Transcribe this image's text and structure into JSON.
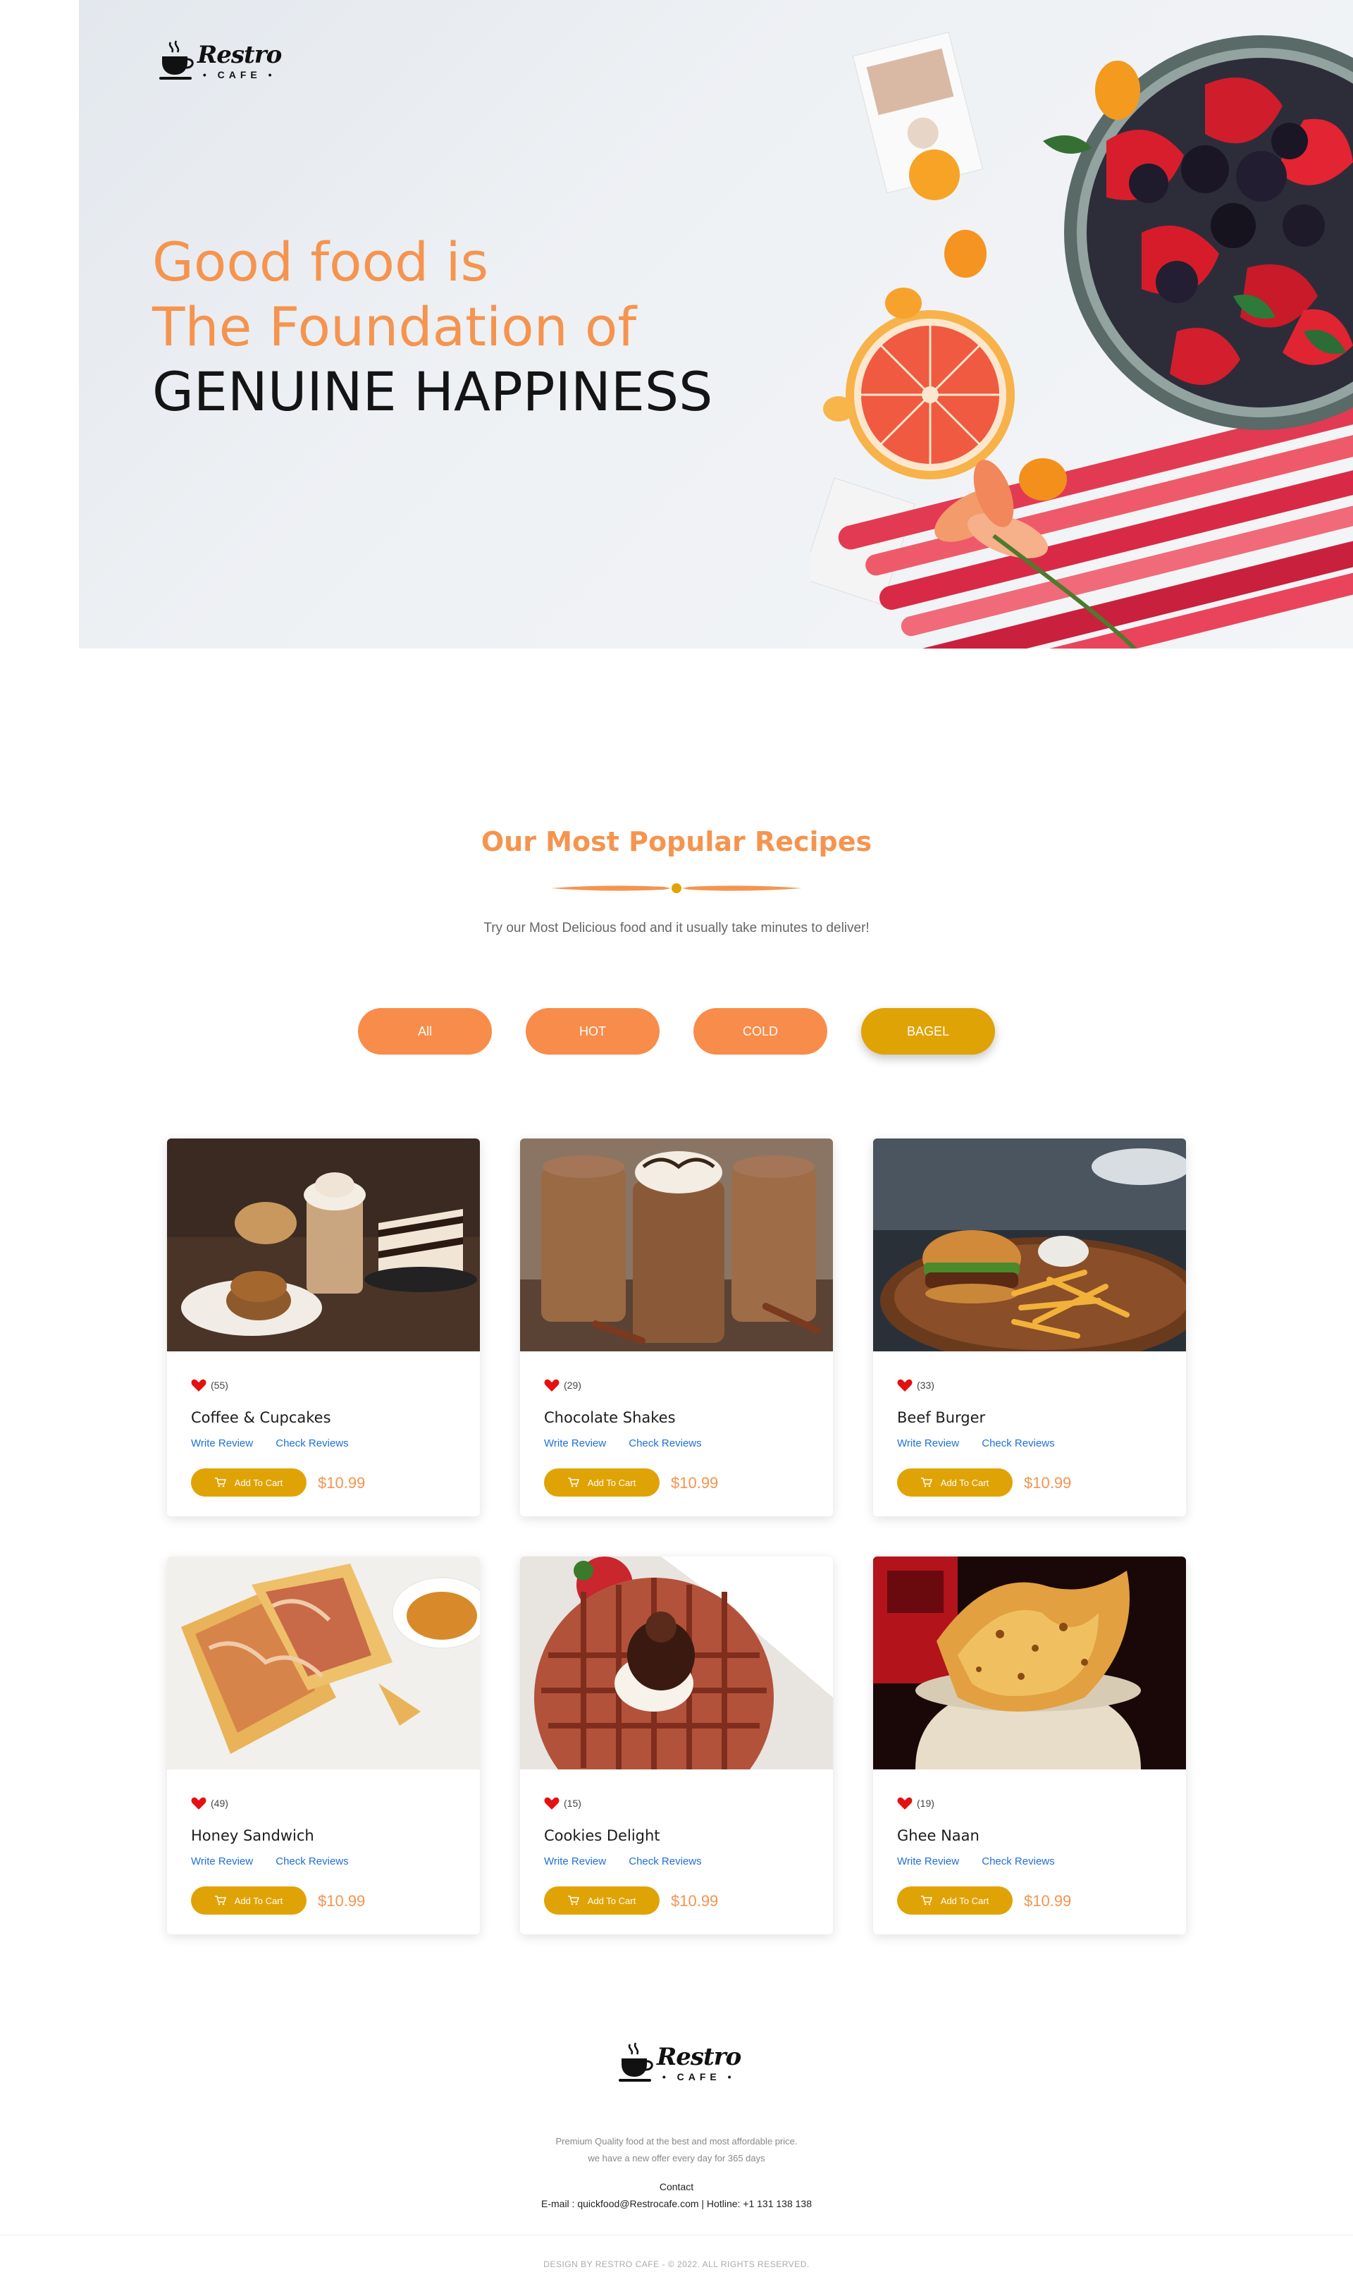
{
  "brand": {
    "name": "Restro",
    "sub": "• CAFE •"
  },
  "hero": {
    "line1": "Good food is",
    "line2": "The Foundation of",
    "line3": "GENUINE HAPPINESS"
  },
  "popular": {
    "title": "Our Most Popular Recipes",
    "subtitle": "Try our Most Delicious food and it usually take minutes to deliver!",
    "filters": [
      {
        "label": "All",
        "active": false
      },
      {
        "label": "HOT",
        "active": false
      },
      {
        "label": "COLD",
        "active": false
      },
      {
        "label": "BAGEL",
        "active": true
      }
    ],
    "items": [
      {
        "name": "Coffee & Cupcakes",
        "rating": "(55)",
        "write_review": "Write Review",
        "check_reviews": "Check Reviews",
        "cart_label": "Add To Cart",
        "price": "$10.99",
        "image": "coffee-cupcakes"
      },
      {
        "name": "Chocolate Shakes",
        "rating": "(29)",
        "write_review": "Write Review",
        "check_reviews": "Check Reviews",
        "cart_label": "Add To Cart",
        "price": "$10.99",
        "image": "chocolate-shakes"
      },
      {
        "name": "Beef Burger",
        "rating": "(33)",
        "write_review": "Write Review",
        "check_reviews": "Check Reviews",
        "cart_label": "Add To Cart",
        "price": "$10.99",
        "image": "beef-burger"
      },
      {
        "name": "Honey Sandwich",
        "rating": "(49)",
        "write_review": "Write Review",
        "check_reviews": "Check Reviews",
        "cart_label": "Add To Cart",
        "price": "$10.99",
        "image": "honey-sandwich"
      },
      {
        "name": "Cookies Delight",
        "rating": "(15)",
        "write_review": "Write Review",
        "check_reviews": "Check Reviews",
        "cart_label": "Add To Cart",
        "price": "$10.99",
        "image": "cookies-delight"
      },
      {
        "name": "Ghee Naan",
        "rating": "(19)",
        "write_review": "Write Review",
        "check_reviews": "Check Reviews",
        "cart_label": "Add To Cart",
        "price": "$10.99",
        "image": "ghee-naan"
      }
    ]
  },
  "footer": {
    "line1": "Premium Quality food at the best and most affordable price.",
    "line2": "we have a new offer every day for 365 days",
    "contact_heading": "Contact",
    "contact_line": "E-mail : quickfood@Restrocafe.com | Hotline: +1 131 138 138",
    "copyright": "DESIGN BY RESTRO CAFE - © 2022. ALL RIGHTS RESERVED."
  },
  "colors": {
    "accent_orange": "#f5944f",
    "filter_orange": "#f88c4a",
    "gold": "#e0a305",
    "link_blue": "#1f6fd6",
    "heart_red": "#e51010"
  },
  "icons": {
    "logo": "coffee-cup-icon",
    "rating": "heart-icon",
    "cart": "cart-icon"
  }
}
